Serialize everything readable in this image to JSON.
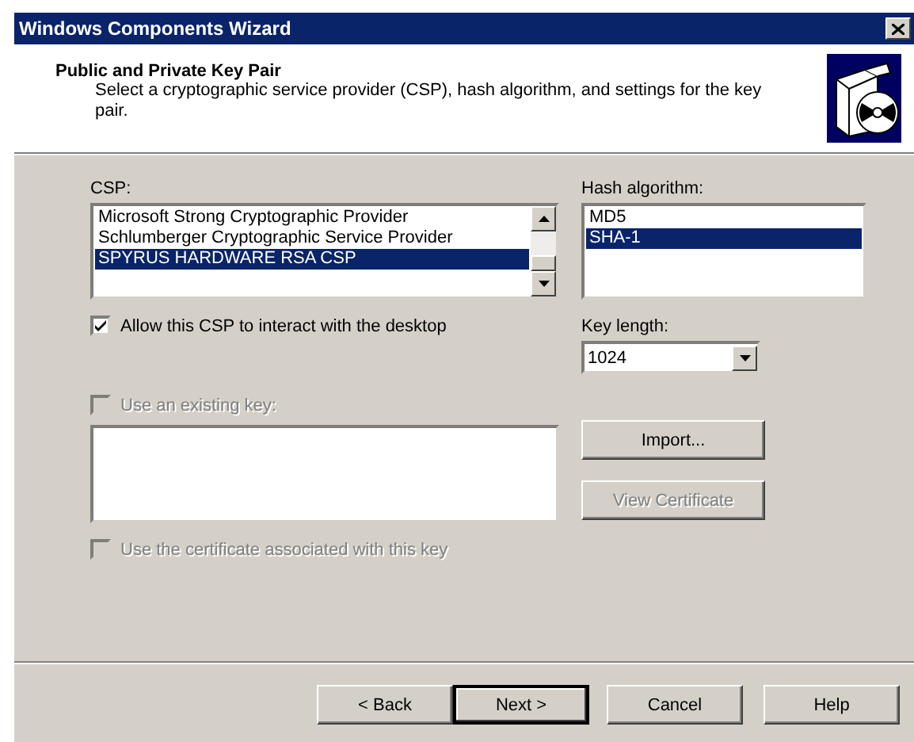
{
  "window": {
    "title": "Windows Components Wizard"
  },
  "header": {
    "title": "Public and Private Key Pair",
    "description": "Select a cryptographic service provider (CSP), hash algorithm, and settings for the key pair."
  },
  "csp": {
    "label": "CSP:",
    "items": [
      {
        "text": "Microsoft Strong Cryptographic Provider",
        "selected": false
      },
      {
        "text": "Schlumberger Cryptographic Service Provider",
        "selected": false
      },
      {
        "text": "SPYRUS HARDWARE RSA CSP",
        "selected": true
      }
    ]
  },
  "allow_desktop": {
    "label": "Allow this CSP to interact with the desktop",
    "checked": true,
    "disabled": false
  },
  "hash_algorithm": {
    "label": "Hash algorithm:",
    "items": [
      {
        "text": "MD5",
        "selected": false
      },
      {
        "text": "SHA-1",
        "selected": true
      }
    ]
  },
  "key_length": {
    "label": "Key length:",
    "value": "1024"
  },
  "existing_key": {
    "label": "Use an existing key:",
    "checked": false,
    "disabled": true
  },
  "import_button": {
    "label": "Import...",
    "disabled": false
  },
  "view_certificate_button": {
    "label": "View Certificate",
    "disabled": true
  },
  "use_certificate": {
    "label": "Use the certificate associated with this key",
    "checked": false,
    "disabled": true
  },
  "buttons": [
    {
      "label": "< Back",
      "default": false
    },
    {
      "label": "Next >",
      "default": true
    },
    {
      "label": "Cancel",
      "default": false
    },
    {
      "label": "Help",
      "default": false
    }
  ]
}
